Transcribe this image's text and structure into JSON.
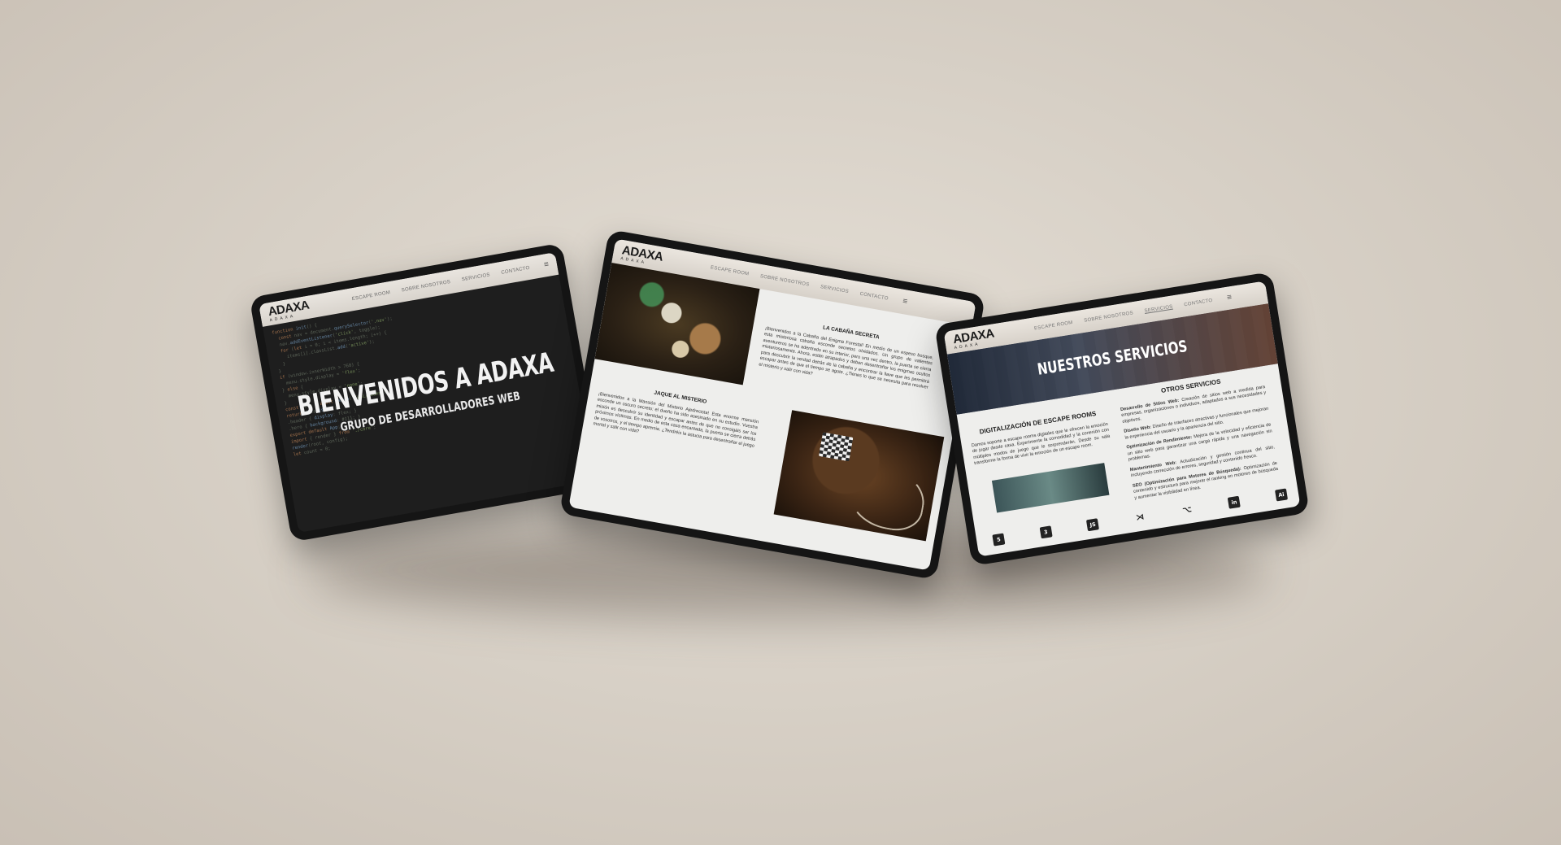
{
  "nav": {
    "logo": "ADAXA",
    "logo_sub": "ADAXA",
    "links": [
      "ESCAPE ROOM",
      "SOBRE NOSOTROS",
      "SERVICIOS",
      "CONTACTO"
    ],
    "menu_icon": "≡"
  },
  "home": {
    "title": "BIENVENIDOS A ADAXA",
    "subtitle": "GRUPO DE DESARROLLADORES WEB"
  },
  "escape": {
    "cabana_title": "LA CABAÑA SECRETA",
    "cabana_text": "¡Bienvenidos a la Cabaña del Enigma Forestal! En medio de un espeso bosque, esta misteriosa cabaña esconde secretos olvidados. Un grupo de valientes aventureros se ha adentrado en su interior, pero una vez dentro, la puerta se cierra misteriosamente. Ahora, están atrapados y deben desentrañar los enigmas ocultos para descubrir la verdad detrás de la cabaña y encontrar la llave que les permitirá escapar antes de que el tiempo se agote. ¿Tienes lo que se necesita para resolver el misterio y salir con vida?",
    "jaque_title": "JAQUE AL MISTERIO",
    "jaque_text": "¡Bienvenidos a la Mansión del Misterio Ajedrecista! Esta enorme mansión esconde un oscuro secreto: el dueño ha sido asesinado en su estudio. Vuestra misión es descubrir su identidad y escapar antes de que no consigáis ser los próximos víctimas. En medio de esta casa encantada, la puerta se cierra detrás de vosotros, y el tiempo apremia. ¿Tendréis la astucia para desentrañar el juego mortal y salir con vida?"
  },
  "services": {
    "banner_title": "NUESTROS SERVICIOS",
    "digital_title": "DIGITALIZACIÓN DE ESCAPE ROOMS",
    "digital_text": "Damos soporte a escape rooms digitales que le ofrecen la emoción de jugar desde casa. Experimente la comodidad y la conexión con múltiples modos de juego que le sorprenderán. Desde su sala transforme la forma de vivir la emoción de un escape room.",
    "other_title": "OTROS SERVICIOS",
    "items": [
      {
        "name": "Desarrollo de Sitios Web:",
        "text": "Creación de sitios web a medida para empresas, organizaciones o individuos, adaptados a sus necesidades y objetivos."
      },
      {
        "name": "Diseño Web:",
        "text": "Diseño de interfaces atractivas y funcionales que mejoran la experiencia del usuario y la apariencia del sitio."
      },
      {
        "name": "Optimización de Rendimiento:",
        "text": "Mejora de la velocidad y eficiencia de un sitio web para garantizar una carga rápida y una navegación sin problemas."
      },
      {
        "name": "Mantenimiento Web:",
        "text": "Actualización y gestión continua del sitio, incluyendo corrección de errores, seguridad y contenido fresco."
      },
      {
        "name": "SEO (Optimización para Motores de Búsqueda):",
        "text": "Optimización de contenido y estructura para mejorar el ranking en motores de búsqueda y aumentar la visibilidad en línea."
      }
    ],
    "tech_icons": [
      {
        "icon": "html5-icon",
        "label": "5"
      },
      {
        "icon": "css3-icon",
        "label": "3"
      },
      {
        "icon": "javascript-icon",
        "label": "JS"
      },
      {
        "icon": "vscode-icon",
        "label": "⋊"
      },
      {
        "icon": "git-icon",
        "label": "⌥"
      },
      {
        "icon": "linkedin-icon",
        "label": "in"
      },
      {
        "icon": "illustrator-icon",
        "label": "Ai"
      }
    ]
  }
}
